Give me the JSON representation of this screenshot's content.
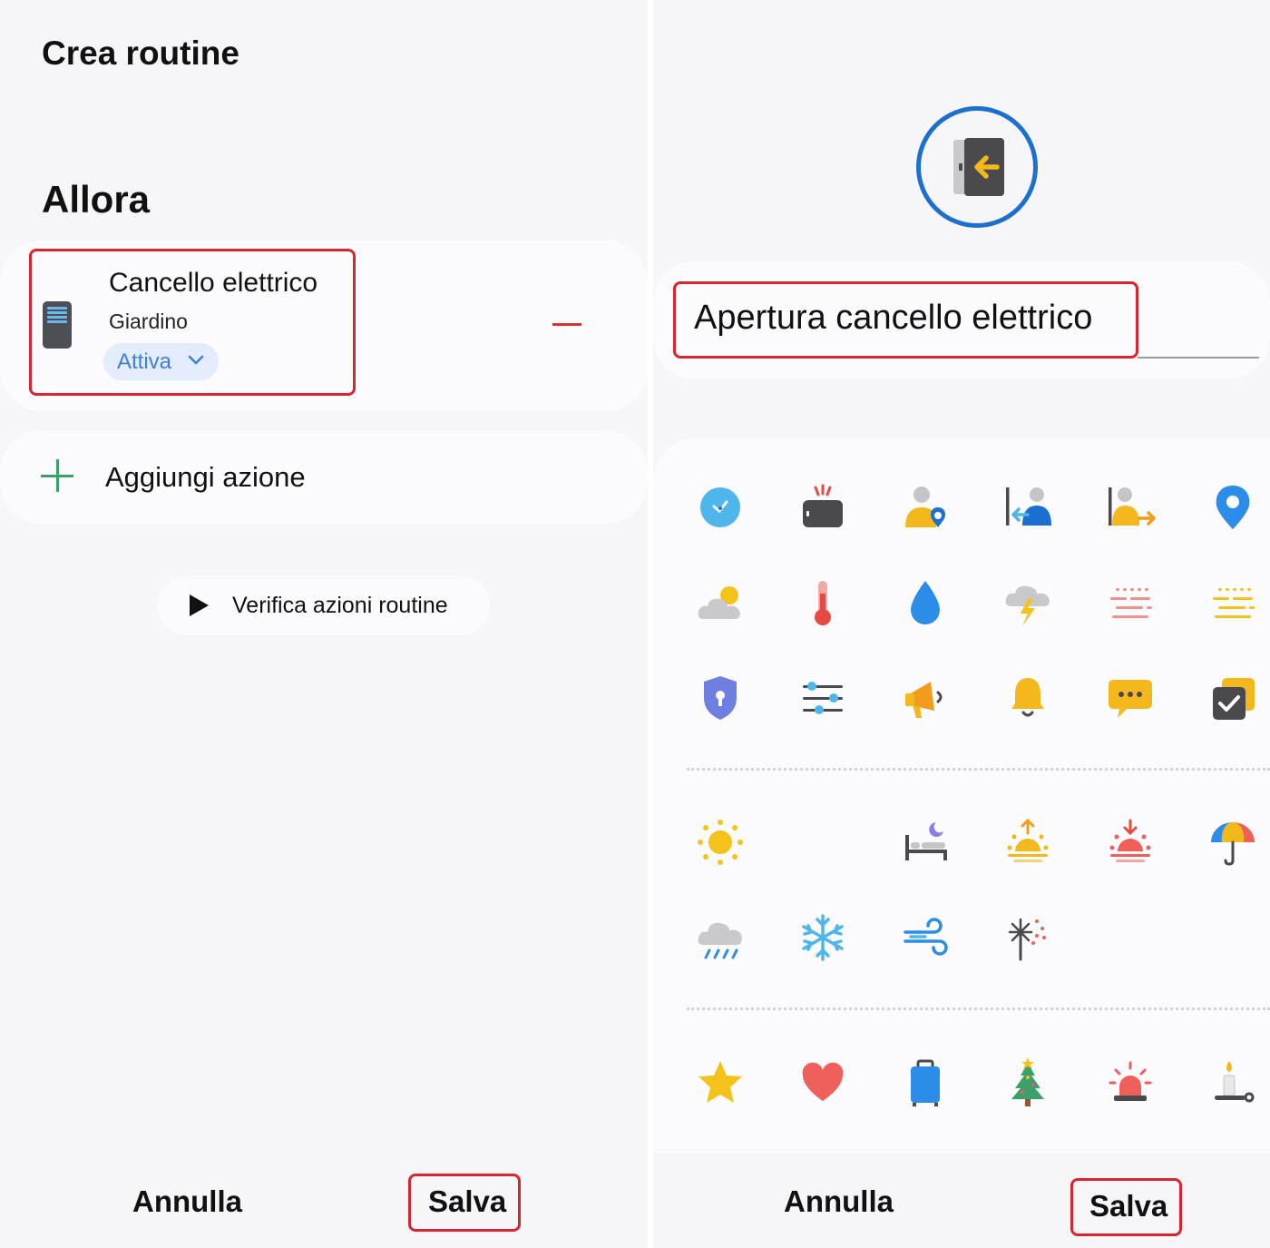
{
  "left": {
    "header": {
      "title": "Crea routine"
    },
    "section_title": "Allora",
    "action": {
      "device_name": "Cancello elettrico",
      "device_location": "Giardino",
      "state": "Attiva",
      "device_icon": "tower-device-icon",
      "remove_icon": "minus-icon"
    },
    "add_action": {
      "label": "Aggiungi azione",
      "icon": "plus-icon"
    },
    "verify": {
      "label": "Verifica azioni routine",
      "icon": "play-icon"
    },
    "footer": {
      "cancel": "Annulla",
      "save": "Salva"
    }
  },
  "right": {
    "selected_icon": "door-enter-icon",
    "routine_name": "Apertura cancello elettrico",
    "icon_grid": {
      "group_1": [
        "clock-icon",
        "alarm-clock-icon",
        "person-location-icon",
        "person-arrive-icon",
        "person-leave-icon",
        "location-pin-icon",
        "partly-cloudy-icon",
        "thermometer-icon",
        "water-drop-icon",
        "thunderstorm-icon",
        "fog-red-icon",
        "fog-yellow-icon",
        "shield-lock-icon",
        "sliders-icon",
        "megaphone-icon",
        "bell-icon",
        "chat-bubble-icon",
        "checkbox-stack-icon"
      ],
      "group_2": [
        "sun-icon",
        "moon-icon",
        "bed-icon",
        "sunrise-icon",
        "sunset-icon",
        "umbrella-icon",
        "rain-icon",
        "snowflake-icon",
        "wind-icon",
        "sparkler-icon"
      ],
      "group_3": [
        "star-icon",
        "heart-icon",
        "suitcase-icon",
        "christmas-tree-icon",
        "siren-icon",
        "candle-icon"
      ]
    },
    "footer": {
      "cancel": "Annulla",
      "save": "Salva"
    }
  },
  "colors": {
    "highlight_red": "#d9252f",
    "accent_blue": "#1a6fd1",
    "chip_text": "#3f7fd3",
    "add_green": "#3aa06c",
    "remove_red": "#d9352f"
  }
}
